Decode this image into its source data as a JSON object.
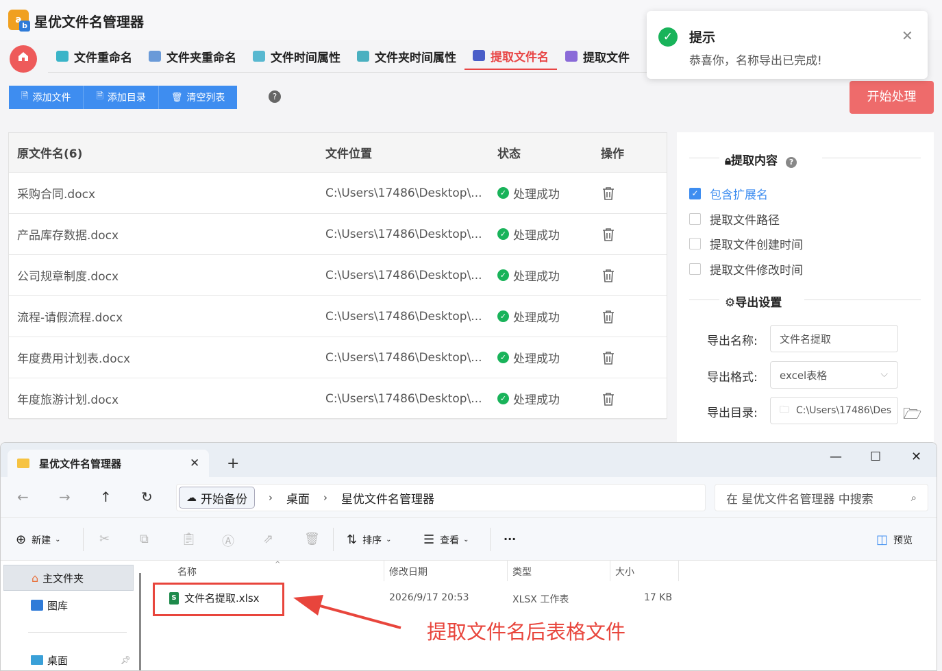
{
  "app": {
    "title": "星优文件名管理器",
    "logo_letter": "a",
    "logo_corner": "b",
    "accent_color": "#e84545",
    "tabs": [
      {
        "label": "文件重命名",
        "active": false
      },
      {
        "label": "文件夹重命名",
        "active": false
      },
      {
        "label": "文件时间属性",
        "active": false
      },
      {
        "label": "文件夹时间属性",
        "active": false
      },
      {
        "label": "提取文件名",
        "active": true
      },
      {
        "label": "提取文件",
        "active": false
      }
    ],
    "toolbar": {
      "add_file": "添加文件",
      "add_dir": "添加目录",
      "clear_list": "清空列表",
      "help": "?",
      "start": "开始处理"
    },
    "table": {
      "headers": [
        "原文件名(6)",
        "文件位置",
        "状态",
        "操作"
      ],
      "rows": [
        {
          "name": "采购合同.docx",
          "location": "C:\\Users\\17486\\Desktop\\...",
          "status": "处理成功"
        },
        {
          "name": "产品库存数据.docx",
          "location": "C:\\Users\\17486\\Desktop\\...",
          "status": "处理成功"
        },
        {
          "name": "公司规章制度.docx",
          "location": "C:\\Users\\17486\\Desktop\\...",
          "status": "处理成功"
        },
        {
          "name": "流程-请假流程.docx",
          "location": "C:\\Users\\17486\\Desktop\\...",
          "status": "处理成功"
        },
        {
          "name": "年度费用计划表.docx",
          "location": "C:\\Users\\17486\\Desktop\\...",
          "status": "处理成功"
        },
        {
          "name": "年度旅游计划.docx",
          "location": "C:\\Users\\17486\\Desktop\\...",
          "status": "处理成功"
        }
      ]
    },
    "settings": {
      "extract_title": "提取内容",
      "options": [
        {
          "label": "包含扩展名",
          "checked": true
        },
        {
          "label": "提取文件路径",
          "checked": false
        },
        {
          "label": "提取文件创建时间",
          "checked": false
        },
        {
          "label": "提取文件修改时间",
          "checked": false
        }
      ],
      "export_title": "导出设置",
      "export_name_label": "导出名称:",
      "export_name_value": "文件名提取",
      "export_format_label": "导出格式:",
      "export_format_value": "excel表格",
      "export_dir_label": "导出目录:",
      "export_dir_value": "C:\\Users\\17486\\Des"
    },
    "toast": {
      "title": "提示",
      "message": "恭喜你，名称导出已完成!"
    }
  },
  "explorer": {
    "tab_title": "星优文件名管理器",
    "breadcrumbs": [
      "开始备份",
      "桌面",
      "星优文件名管理器"
    ],
    "search_placeholder": "在 星优文件名管理器 中搜索",
    "cmd": {
      "new": "新建",
      "sort": "排序",
      "view": "查看",
      "more": "···",
      "preview": "预览"
    },
    "nav": [
      {
        "label": "主文件夹",
        "selected": true
      },
      {
        "label": "图库",
        "selected": false
      },
      {
        "label": "桌面",
        "selected": false
      }
    ],
    "columns": [
      "名称",
      "修改日期",
      "类型",
      "大小"
    ],
    "files": [
      {
        "name": "文件名提取.xlsx",
        "modified": "2026/9/17 20:53",
        "type": "XLSX 工作表",
        "size": "17 KB"
      }
    ]
  },
  "annotation": {
    "text": "提取文件名后表格文件",
    "color": "#e8453c"
  }
}
